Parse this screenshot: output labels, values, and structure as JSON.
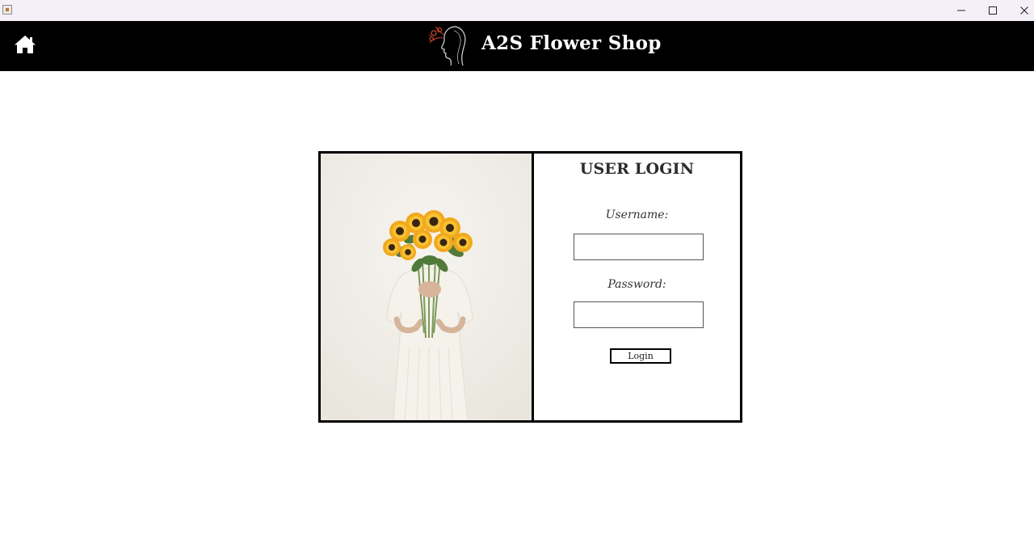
{
  "window": {
    "icon": "java-app-icon",
    "controls": [
      "minimize-icon",
      "maximize-icon",
      "close-icon"
    ]
  },
  "header": {
    "home_icon": "home-icon",
    "logo_icon": "woman-silhouette-logo",
    "brand": "A2S Flower Shop"
  },
  "login": {
    "title": "USER LOGIN",
    "username_label": "Username:",
    "username_value": "",
    "password_label": "Password:",
    "password_value": "",
    "button_label": "Login"
  },
  "photo": {
    "subject": "woman-holding-sunflowers-photo"
  },
  "colors": {
    "header_bg": "#000000",
    "header_text": "#ffffff",
    "page_bg": "#ffffff",
    "card_border": "#000000"
  }
}
